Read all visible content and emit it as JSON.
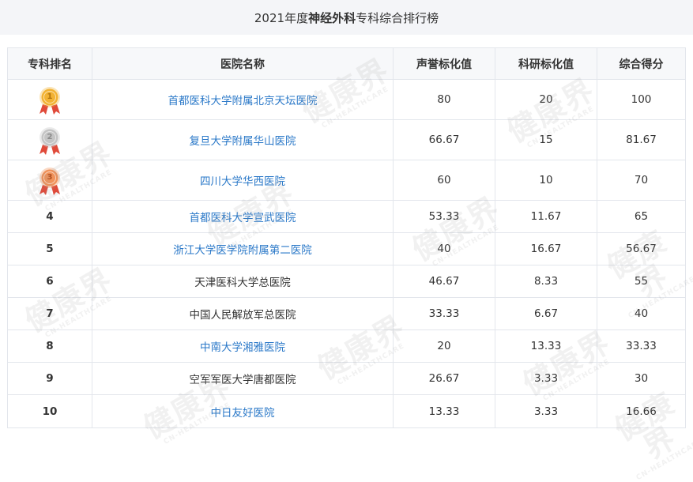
{
  "title": {
    "prefix": "2021年度",
    "specialty": "神经外科",
    "suffix": "专科综合排行榜"
  },
  "columns": [
    "专科排名",
    "医院名称",
    "声誉标化值",
    "科研标化值",
    "综合得分"
  ],
  "medal_colors": {
    "gold": "#f2b233",
    "silver": "#c4c4c4",
    "bronze": "#f0925a",
    "ribbon_red": "#e04a3a"
  },
  "link_color": "#2a78c8",
  "rows": [
    {
      "rank": "1",
      "medal": "gold",
      "hospital": "首都医科大学附属北京天坛医院",
      "linked": true,
      "reputation": "80",
      "research": "20",
      "total": "100"
    },
    {
      "rank": "2",
      "medal": "silver",
      "hospital": "复旦大学附属华山医院",
      "linked": true,
      "reputation": "66.67",
      "research": "15",
      "total": "81.67"
    },
    {
      "rank": "3",
      "medal": "bronze",
      "hospital": "四川大学华西医院",
      "linked": true,
      "reputation": "60",
      "research": "10",
      "total": "70"
    },
    {
      "rank": "4",
      "medal": "",
      "hospital": "首都医科大学宣武医院",
      "linked": true,
      "reputation": "53.33",
      "research": "11.67",
      "total": "65"
    },
    {
      "rank": "5",
      "medal": "",
      "hospital": "浙江大学医学院附属第二医院",
      "linked": true,
      "reputation": "40",
      "research": "16.67",
      "total": "56.67"
    },
    {
      "rank": "6",
      "medal": "",
      "hospital": "天津医科大学总医院",
      "linked": false,
      "reputation": "46.67",
      "research": "8.33",
      "total": "55"
    },
    {
      "rank": "7",
      "medal": "",
      "hospital": "中国人民解放军总医院",
      "linked": false,
      "reputation": "33.33",
      "research": "6.67",
      "total": "40"
    },
    {
      "rank": "8",
      "medal": "",
      "hospital": "中南大学湘雅医院",
      "linked": true,
      "reputation": "20",
      "research": "13.33",
      "total": "33.33"
    },
    {
      "rank": "9",
      "medal": "",
      "hospital": "空军军医大学唐都医院",
      "linked": false,
      "reputation": "26.67",
      "research": "3.33",
      "total": "30"
    },
    {
      "rank": "10",
      "medal": "",
      "hospital": "中日友好医院",
      "linked": true,
      "reputation": "13.33",
      "research": "3.33",
      "total": "16.66"
    }
  ],
  "watermark": {
    "logo_text": "健康界",
    "sub_text": "CN-HEALTHCARE"
  }
}
